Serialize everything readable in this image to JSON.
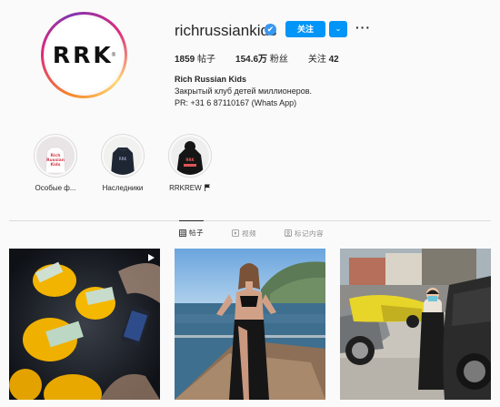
{
  "profile": {
    "username": "richrussiankids",
    "verified_glyph": "✔",
    "avatar_text": "RRK",
    "avatar_reg": "®",
    "follow_label": "关注",
    "dropdown_glyph": "⌄",
    "more_glyph": "···",
    "stats": {
      "posts_num": "1859",
      "posts_label": " 帖子",
      "followers_num": "154.6万",
      "followers_label": " 粉丝",
      "following_label": "关注 ",
      "following_num": "42"
    },
    "bio": {
      "name": "Rich Russian Kids",
      "line1": "Закрытый клуб детей миллионеров.",
      "line2": "PR: +31 6 87110167 (Whats App)"
    }
  },
  "highlights": [
    {
      "label": "Особые ф..."
    },
    {
      "label": "Наследники"
    },
    {
      "label": "RRKREW"
    }
  ],
  "tabs": [
    {
      "label": "帖子",
      "icon": "grid-icon"
    },
    {
      "label": "视频",
      "icon": "video-icon"
    },
    {
      "label": "标记内容",
      "icon": "tag-icon"
    }
  ],
  "colors": {
    "accent": "#0095f6",
    "verified": "#3897f0",
    "text": "#262626",
    "muted": "#8e8e8e",
    "background": "#fafafa"
  }
}
